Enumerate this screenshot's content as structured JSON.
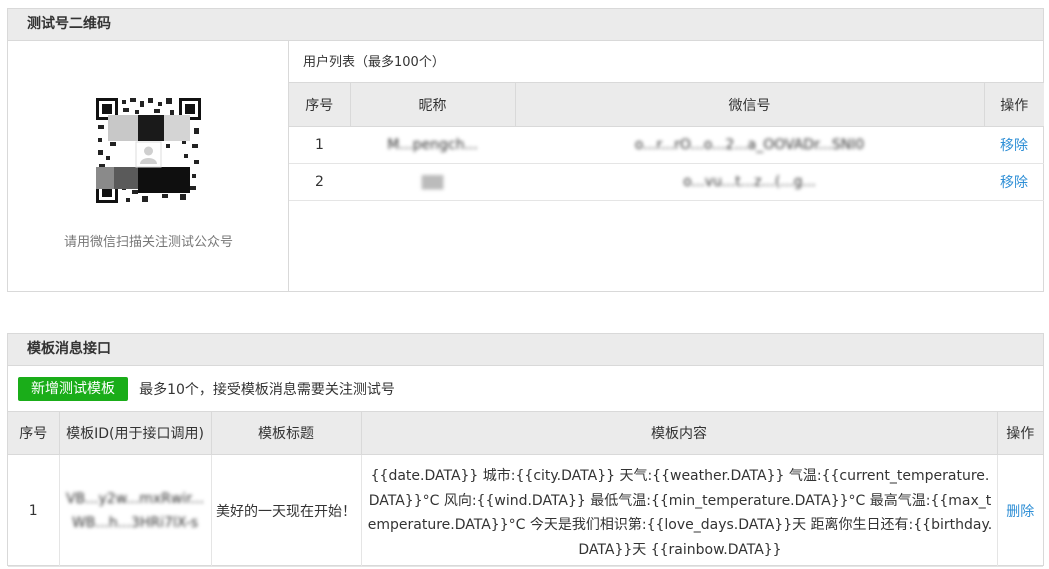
{
  "qr_section": {
    "title": "测试号二维码",
    "caption": "请用微信扫描关注测试公众号",
    "qr_icon": "qr-code"
  },
  "user_list": {
    "title": "用户列表（最多100个）",
    "columns": [
      "序号",
      "昵称",
      "微信号",
      "操作"
    ],
    "rows": [
      {
        "index": "1",
        "nickname": "M...pengch...",
        "wechat_id": "o...r...rO...o...2...a_OOVADr...SNI0",
        "action": "移除"
      },
      {
        "index": "2",
        "nickname": "▇▇",
        "wechat_id": "o...vu...t...z...(...g...",
        "action": "移除"
      }
    ]
  },
  "template_section": {
    "title": "模板消息接口",
    "add_button": "新增测试模板",
    "hint": "最多10个，接受模板消息需要关注测试号",
    "columns": [
      "序号",
      "模板ID(用于接口调用)",
      "模板标题",
      "模板内容",
      "操作"
    ],
    "rows": [
      {
        "index": "1",
        "template_id": "VB...y2w...mxRwir...WB...h...3HRi7lX-s",
        "title": "美好的一天现在开始！",
        "content": "{{date.DATA}} 城市:{{city.DATA}} 天气:{{weather.DATA}} 气温:{{current_temperature.DATA}}°C 风向:{{wind.DATA}} 最低气温:{{min_temperature.DATA}}°C 最高气温:{{max_temperature.DATA}}°C 今天是我们相识第:{{love_days.DATA}}天 距离你生日还有:{{birthday.DATA}}天 {{rainbow.DATA}}",
        "action": "删除"
      }
    ]
  },
  "colors": {
    "accent_green": "#1aad19",
    "link_blue": "#2f8fd6",
    "header_gray": "#ebebeb",
    "border_gray": "#d9d9d9"
  }
}
